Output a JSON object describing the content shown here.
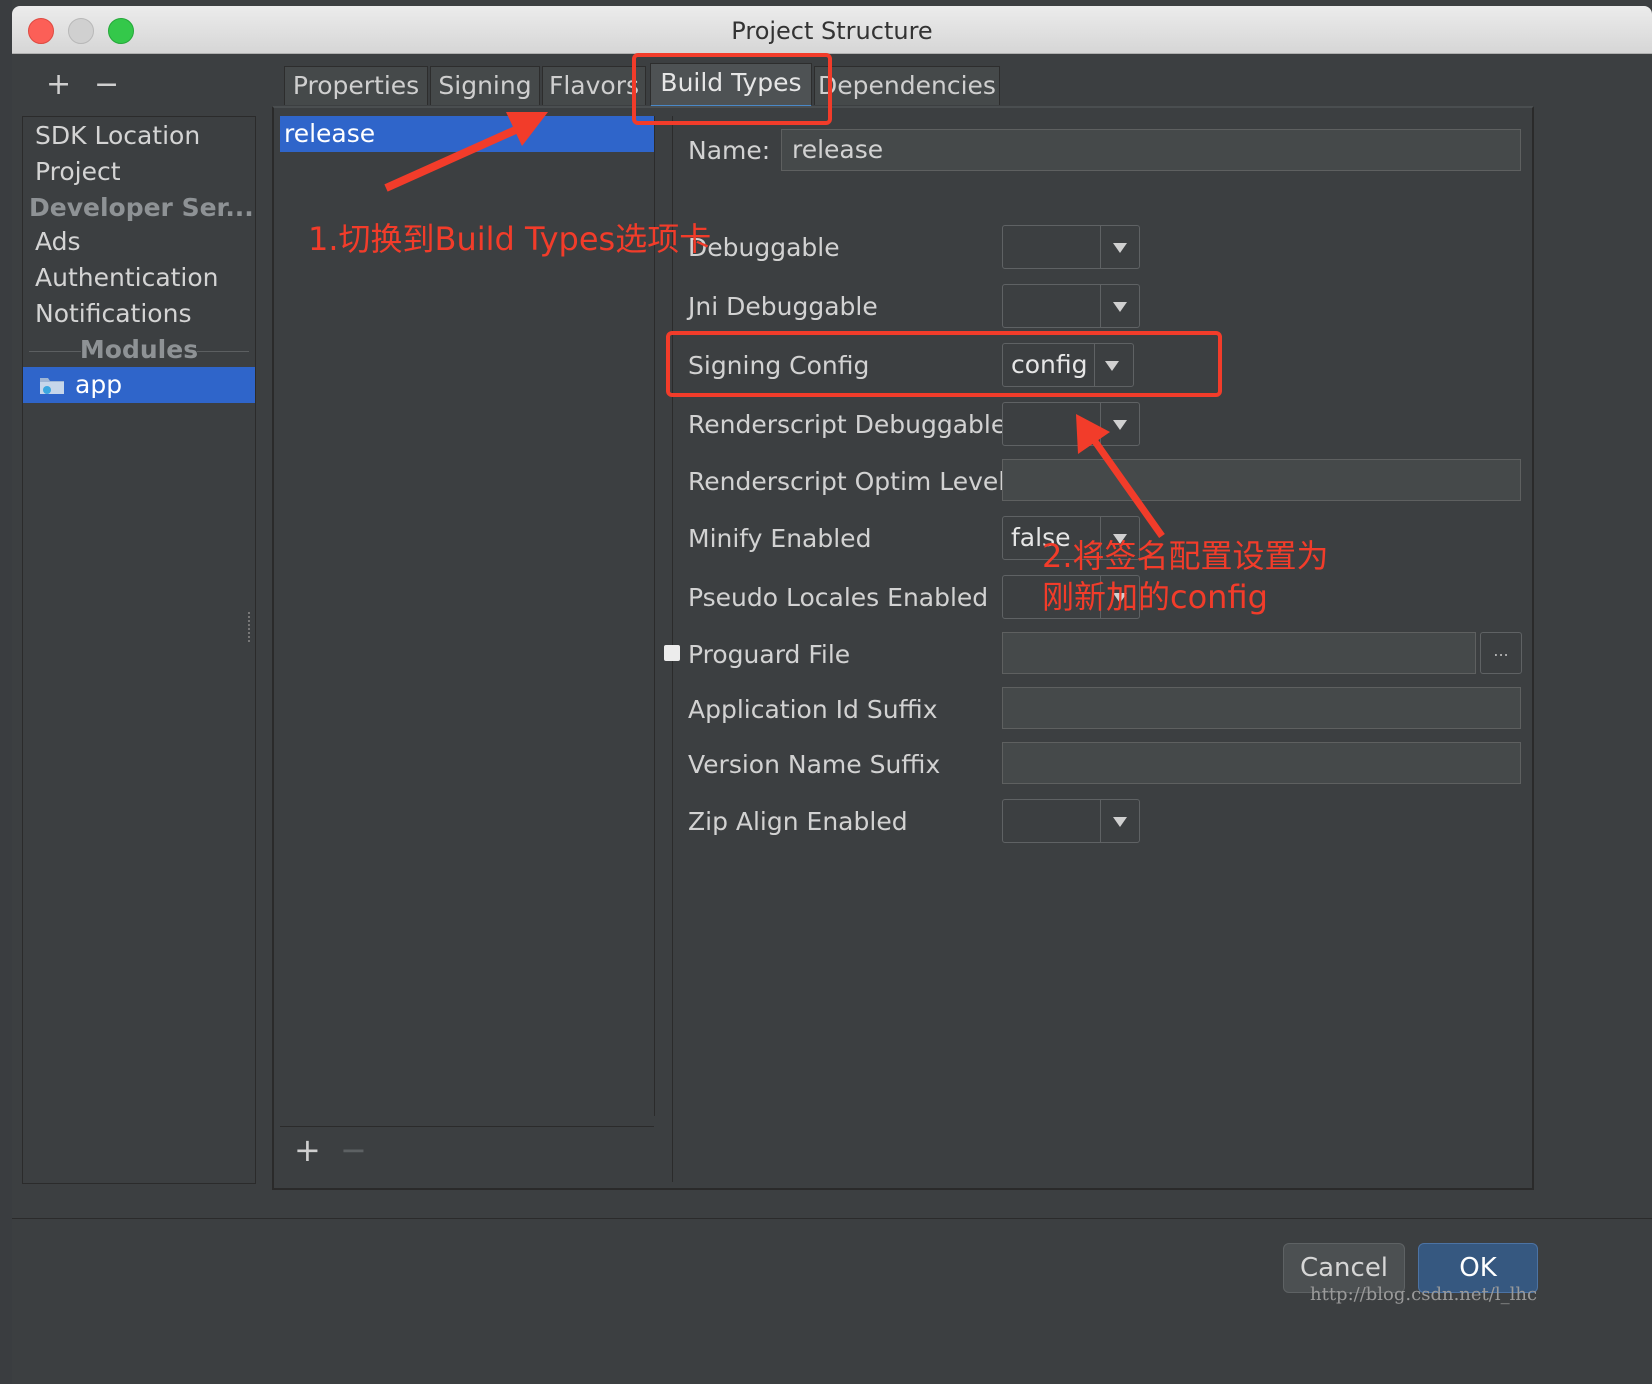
{
  "window": {
    "title": "Project Structure"
  },
  "sidebar": {
    "add": "+",
    "remove": "−",
    "items": [
      "SDK Location",
      "Project",
      "Developer Ser...",
      "Ads",
      "Authentication",
      "Notifications"
    ],
    "modules_label": "Modules",
    "selected_module": "app"
  },
  "tabs": [
    "Properties",
    "Signing",
    "Flavors",
    "Build Types",
    "Dependencies"
  ],
  "active_tab": "Build Types",
  "build_types": {
    "selected": "release",
    "add": "+",
    "remove": "−"
  },
  "form": {
    "name_label": "Name:",
    "name_value": "release",
    "debuggable": "Debuggable",
    "jni_debuggable": "Jni Debuggable",
    "signing_config": "Signing Config",
    "signing_config_value": "config",
    "renderscript_debuggable": "Renderscript Debuggable",
    "renderscript_optim_level": "Renderscript Optim Level",
    "minify_enabled": "Minify Enabled",
    "minify_enabled_value": "false",
    "pseudo_locales_enabled": "Pseudo Locales Enabled",
    "proguard_file": "Proguard File",
    "proguard_browse": "...",
    "application_id_suffix": "Application Id Suffix",
    "version_name_suffix": "Version Name Suffix",
    "zip_align_enabled": "Zip Align Enabled"
  },
  "buttons": {
    "cancel": "Cancel",
    "ok": "OK"
  },
  "annotations": {
    "step1": "1.切换到Build Types选项卡",
    "step2_line1": "2.将签名配置设置为",
    "step2_line2": "刚新加的config"
  },
  "watermark": "http://blog.csdn.net/l_lhc",
  "colors": {
    "accent": "#f23c2a",
    "selection": "#2f65ca",
    "ok_button": "#365880"
  }
}
